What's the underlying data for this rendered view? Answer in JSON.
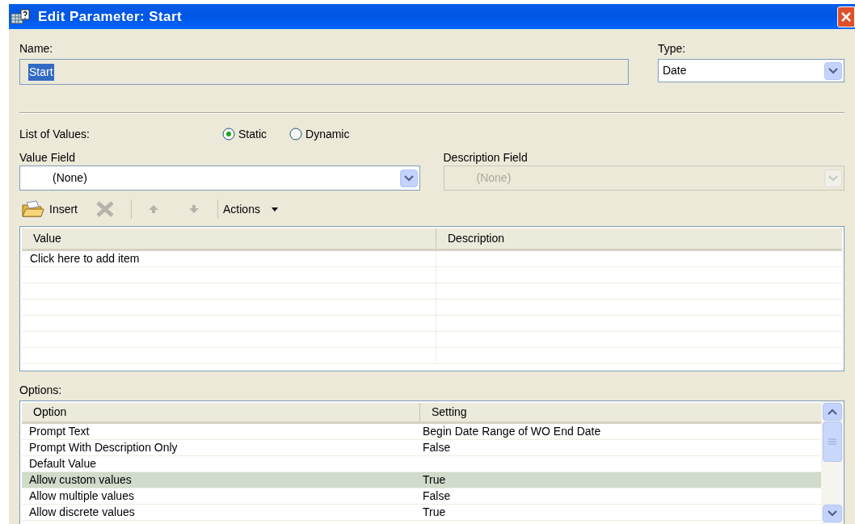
{
  "window": {
    "title": "Edit Parameter: Start"
  },
  "name": {
    "label": "Name:",
    "value": "Start"
  },
  "type": {
    "label": "Type:",
    "value": "Date"
  },
  "list_of_values": {
    "label": "List of Values:",
    "options": [
      {
        "label": "Static",
        "selected": true
      },
      {
        "label": "Dynamic",
        "selected": false
      }
    ]
  },
  "value_field": {
    "label": "Value Field",
    "value": "(None)",
    "disabled": false
  },
  "description_field": {
    "label": "Description Field",
    "value": "(None)",
    "disabled": true
  },
  "toolbar": {
    "insert": "Insert",
    "actions": "Actions"
  },
  "values_table": {
    "columns": [
      "Value",
      "Description"
    ],
    "rows": [
      {
        "value": "Click here to add item"
      }
    ]
  },
  "options": {
    "label": "Options:",
    "columns": [
      "Option",
      "Setting"
    ],
    "rows": [
      {
        "option": "Prompt Text",
        "setting": "Begin Date Range of WO End Date",
        "selected": false
      },
      {
        "option": "Prompt With Description Only",
        "setting": "False",
        "selected": false
      },
      {
        "option": "Default Value",
        "selected": false
      },
      {
        "option": "Allow custom values",
        "setting": "True",
        "selected": true
      },
      {
        "option": "Allow multiple values",
        "setting": "False",
        "selected": false
      },
      {
        "option": "Allow discrete values",
        "setting": "True",
        "selected": false
      }
    ]
  }
}
